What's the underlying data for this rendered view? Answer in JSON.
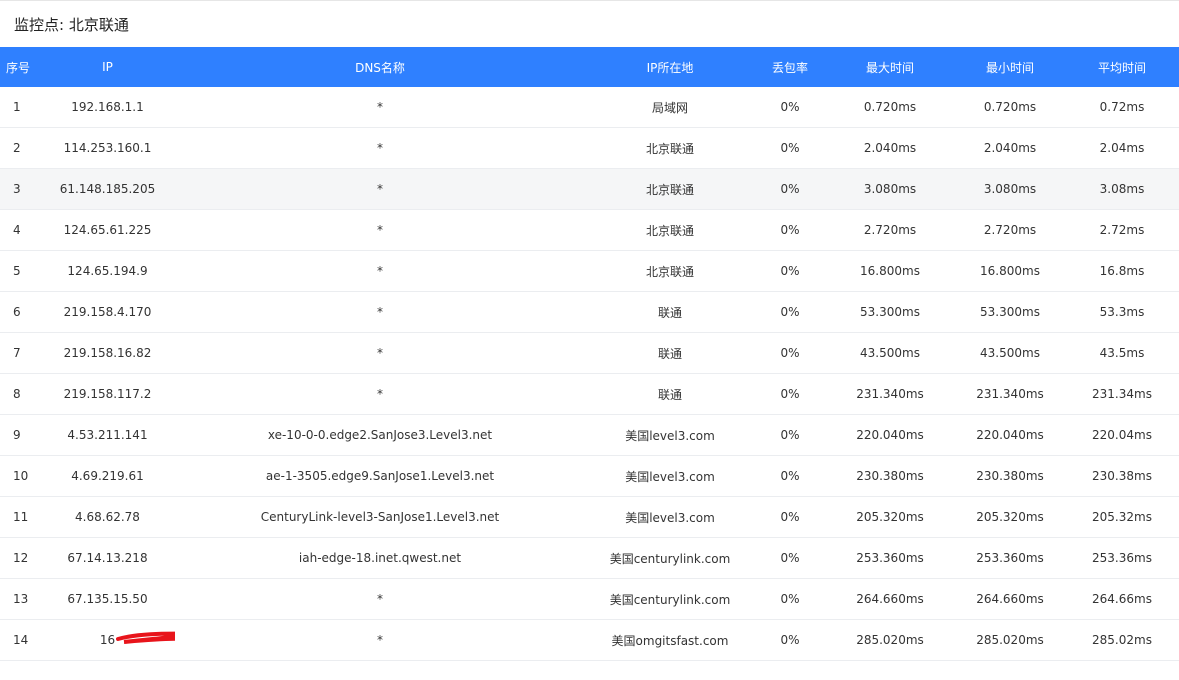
{
  "monitor": {
    "title": "监控点: 北京联通"
  },
  "colors": {
    "header_bg": "#2f80ff",
    "header_text": "#ffffff",
    "stripe_bg": "#f5f6f7",
    "redact_mark": "#e8141b"
  },
  "table": {
    "columns": [
      "序号",
      "IP",
      "DNS名称",
      "IP所在地",
      "丢包率",
      "最大时间",
      "最小时间",
      "平均时间"
    ],
    "rows": [
      {
        "hop": "1",
        "ip": "192.168.1.1",
        "dns": "*",
        "location": "局域网",
        "loss": "0%",
        "max": "0.720ms",
        "min": "0.720ms",
        "avg": "0.72ms"
      },
      {
        "hop": "2",
        "ip": "114.253.160.1",
        "dns": "*",
        "location": "北京联通",
        "loss": "0%",
        "max": "2.040ms",
        "min": "2.040ms",
        "avg": "2.04ms"
      },
      {
        "hop": "3",
        "ip": "61.148.185.205",
        "dns": "*",
        "location": "北京联通",
        "loss": "0%",
        "max": "3.080ms",
        "min": "3.080ms",
        "avg": "3.08ms"
      },
      {
        "hop": "4",
        "ip": "124.65.61.225",
        "dns": "*",
        "location": "北京联通",
        "loss": "0%",
        "max": "2.720ms",
        "min": "2.720ms",
        "avg": "2.72ms"
      },
      {
        "hop": "5",
        "ip": "124.65.194.9",
        "dns": "*",
        "location": "北京联通",
        "loss": "0%",
        "max": "16.800ms",
        "min": "16.800ms",
        "avg": "16.8ms"
      },
      {
        "hop": "6",
        "ip": "219.158.4.170",
        "dns": "*",
        "location": "联通",
        "loss": "0%",
        "max": "53.300ms",
        "min": "53.300ms",
        "avg": "53.3ms"
      },
      {
        "hop": "7",
        "ip": "219.158.16.82",
        "dns": "*",
        "location": "联通",
        "loss": "0%",
        "max": "43.500ms",
        "min": "43.500ms",
        "avg": "43.5ms"
      },
      {
        "hop": "8",
        "ip": "219.158.117.2",
        "dns": "*",
        "location": "联通",
        "loss": "0%",
        "max": "231.340ms",
        "min": "231.340ms",
        "avg": "231.34ms"
      },
      {
        "hop": "9",
        "ip": "4.53.211.141",
        "dns": "xe-10-0-0.edge2.SanJose3.Level3.net",
        "location": "美国level3.com",
        "loss": "0%",
        "max": "220.040ms",
        "min": "220.040ms",
        "avg": "220.04ms"
      },
      {
        "hop": "10",
        "ip": "4.69.219.61",
        "dns": "ae-1-3505.edge9.SanJose1.Level3.net",
        "location": "美国level3.com",
        "loss": "0%",
        "max": "230.380ms",
        "min": "230.380ms",
        "avg": "230.38ms"
      },
      {
        "hop": "11",
        "ip": "4.68.62.78",
        "dns": "CenturyLink-level3-SanJose1.Level3.net",
        "location": "美国level3.com",
        "loss": "0%",
        "max": "205.320ms",
        "min": "205.320ms",
        "avg": "205.32ms"
      },
      {
        "hop": "12",
        "ip": "67.14.13.218",
        "dns": "iah-edge-18.inet.qwest.net",
        "location": "美国centurylink.com",
        "loss": "0%",
        "max": "253.360ms",
        "min": "253.360ms",
        "avg": "253.36ms"
      },
      {
        "hop": "13",
        "ip": "67.135.15.50",
        "dns": "*",
        "location": "美国centurylink.com",
        "loss": "0%",
        "max": "264.660ms",
        "min": "264.660ms",
        "avg": "264.66ms"
      },
      {
        "hop": "14",
        "ip": "16",
        "dns": "*",
        "location": "美国omgitsfast.com",
        "loss": "0%",
        "max": "285.020ms",
        "min": "285.020ms",
        "avg": "285.02ms",
        "redacted": true
      }
    ]
  }
}
